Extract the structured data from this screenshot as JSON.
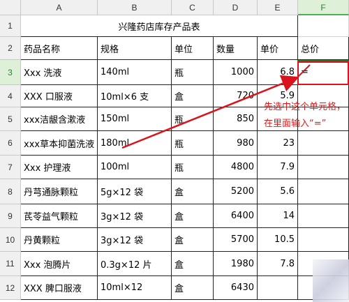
{
  "columns": [
    "A",
    "B",
    "C",
    "D",
    "E",
    "F"
  ],
  "active_column": "F",
  "active_row": "3",
  "title": "兴隆药店库存产品表",
  "headers": [
    "药品名称",
    "规格",
    "单位",
    "数量",
    "单价",
    "总价"
  ],
  "rows": [
    {
      "num": "3",
      "name": "Xxx 洗液",
      "spec": "140ml",
      "unit": "瓶",
      "qty": "1000",
      "price": "6.8",
      "total": "="
    },
    {
      "num": "4",
      "name": "XXX 口服液",
      "spec": "10ml×6 支",
      "unit": "盒",
      "qty": "720",
      "price": "5.9",
      "total": ""
    },
    {
      "num": "5",
      "name": "xxx洁龈含漱液",
      "spec": "150ml",
      "unit": "瓶",
      "qty": "850",
      "price": "",
      "total": ""
    },
    {
      "num": "6",
      "name": "xxx草本抑菌洗液",
      "spec": "180ml",
      "unit": "瓶",
      "qty": "980",
      "price": "23",
      "total": ""
    },
    {
      "num": "7",
      "name": "Xxx 护理液",
      "spec": "100ml",
      "unit": "瓶",
      "qty": "4800",
      "price": "7.9",
      "total": ""
    },
    {
      "num": "8",
      "name": "丹芎通脉颗粒",
      "spec": "5g×12 袋",
      "unit": "盒",
      "qty": "5200",
      "price": "5.6",
      "total": ""
    },
    {
      "num": "9",
      "name": "芪苓益气颗粒",
      "spec": "3g×12 袋",
      "unit": "盒",
      "qty": "6400",
      "price": "14",
      "total": ""
    },
    {
      "num": "10",
      "name": "丹黄颗粒",
      "spec": "3g×12 袋",
      "unit": "盒",
      "qty": "5700",
      "price": "10.5",
      "total": ""
    },
    {
      "num": "11",
      "name": "Xxx 泡腾片",
      "spec": "0.3g×12 片",
      "unit": "盒",
      "qty": "1980",
      "price": "7.8",
      "total": ""
    },
    {
      "num": "12",
      "name": "XXX 脾口服液",
      "spec": "10ml×12",
      "unit": "盒",
      "qty": "6430",
      "price": "",
      "total": ""
    }
  ],
  "annotation": {
    "line1": "先选中这个单元格，",
    "line2": "在里面输入“=”",
    "color": "#e01a1a"
  }
}
